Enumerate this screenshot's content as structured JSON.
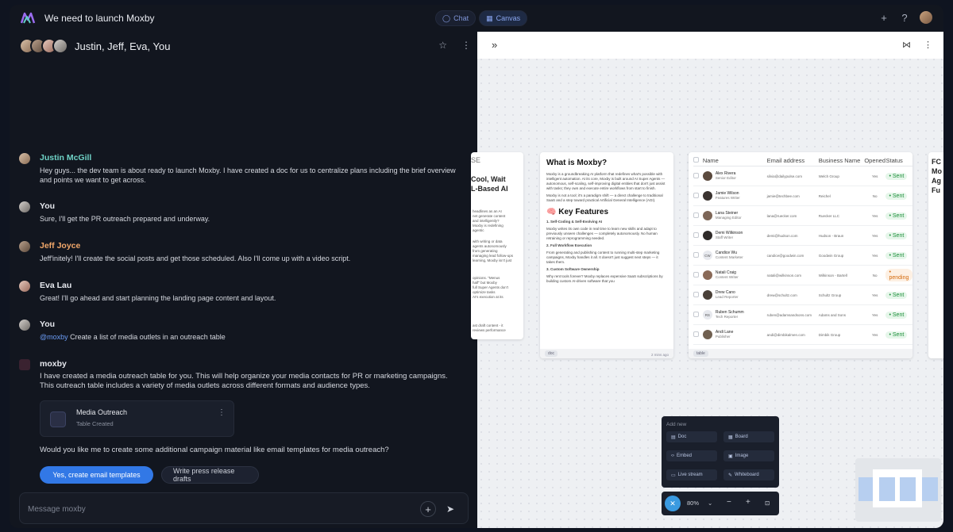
{
  "app": {
    "title": "We need to launch Moxby",
    "views": [
      "Chat",
      "Canvas"
    ],
    "active_view": "Canvas",
    "accent": "#3278e6"
  },
  "chat": {
    "header": "Justin, Jeff, Eva, You",
    "messages": [
      {
        "author": "Justin McGill",
        "color": "#6fd3c6",
        "text": "Hey guys... the dev team is about ready to launch Moxby. I have created a doc for us to centralize plans including the brief overview and points we want to get across."
      },
      {
        "author": "You",
        "color": "#e6e8ee",
        "text": "Sure, I'll get the PR outreach prepared and underway."
      },
      {
        "author": "Jeff Joyce",
        "color": "#f2a86a",
        "text": "Jeff'initely! I'll create the social posts and get those scheduled. Also I'll come up with a video script."
      },
      {
        "author": "Eva Lau",
        "color": "#e6e8ee",
        "text": "Great! I'll go ahead and start planning the landing page content and layout."
      },
      {
        "author": "You",
        "color": "#e6e8ee",
        "mention": "@moxby",
        "text": "Create a list of media outlets in an outreach table"
      },
      {
        "author": "moxby",
        "color": "#e6e8ee",
        "text": "I have created a media outreach table for you. This will help organize your media contacts for PR or marketing campaigns. This outreach table includes a variety of media outlets across different formats and audience types."
      }
    ],
    "attachment": {
      "name": "Media Outreach",
      "subtitle": "Table Created"
    },
    "question": "Would you like me to create some additional campaign material like email templates for media outreach?",
    "cta_primary": "Yes, create email templates",
    "cta_secondary": "Write press release drafts",
    "composer_placeholder": "Message moxby"
  },
  "canvas": {
    "card1": {
      "heading_alt": "SE",
      "heading": "Cool, Wait\nL-Based AI",
      "paragraphs": [
        "headlines as an AI\nnet generate content\nand intelligently?\nMoxby is redefining\nagentic",
        "with writing or data\nagents autonomously\nfrom generating\nmanaging lead follow-ups\nlearning, Moxby isn't just",
        "opinions. \"Menus\nhalf\" but Moxby\nfull Super Agents don't\noptimize tasks\nAI's execution at its",
        "ast draft content - it\nreviews performance"
      ]
    },
    "card2": {
      "title": "What is Moxby?",
      "p1": "Moxby is a groundbreaking AI platform that redefines what's possible with intelligent automation. At its core, Moxby is built around AI Super Agents — autonomous, self-scaling, self-improving digital entities that don't just assist with tasks; they own and execute entire workflows from start to finish.",
      "p2": "Moxby is not a tool; it's a paradigm shift — a direct challenge to traditional SaaS and a step toward practical Artificial General Intelligence (AGI).",
      "features_title": "🧠 Key Features",
      "f1_title": "1. Self-Coding & Self-Evolving AI",
      "f1": "Moxby writes its own code in real time to learn new skills and adapt to previously unseen challenges — completely autonomously. No human retraining or reprogramming needed.",
      "f2_title": "2. Full Workflow Execution",
      "f2": "From generating and publishing content to running multi-step marketing campaigns, Moxby handles it all. It doesn't just suggest next steps — it takes them.",
      "f3_title": "3. Custom Software Ownership",
      "f3": "Why rent tools forever? Moxby replaces expensive SaaS subscriptions by building custom AI-driven software that you",
      "tag": "doc",
      "timestamp": "2 mins ago"
    },
    "card3": {
      "headers": [
        "Name",
        "Email address",
        "Business Name",
        "Opened",
        "Status"
      ],
      "rows": [
        {
          "name": "Alex Rivera",
          "role": "Senior Editor",
          "email": "silvia@dailypulse.com",
          "biz": "Welch Group",
          "opened": "Yes",
          "status": "Sent",
          "initials": ""
        },
        {
          "name": "Jamie Wilson",
          "role": "Features Writer",
          "email": "jamie@techbee.com",
          "biz": "Reichel",
          "opened": "No",
          "status": "Sent",
          "initials": ""
        },
        {
          "name": "Lana Steiner",
          "role": "Managing Editor",
          "email": "lana@ruecker.com",
          "biz": "Ruecker LLC",
          "opened": "Yes",
          "status": "Sent",
          "initials": ""
        },
        {
          "name": "Demi Wilkinson",
          "role": "Staff Writer",
          "email": "demi@hudson.com",
          "biz": "Hudson - Braun",
          "opened": "Yes",
          "status": "Sent",
          "initials": ""
        },
        {
          "name": "Candice Wu",
          "role": "Content Marketer",
          "email": "candice@goodwin.com",
          "biz": "Goodwin Group",
          "opened": "Yes",
          "status": "Sent",
          "initials": "CW"
        },
        {
          "name": "Natali Craig",
          "role": "Content Writer",
          "email": "natali@wilkinson.com",
          "biz": "Wilkinson - Bartell",
          "opened": "No",
          "status": "pending",
          "initials": ""
        },
        {
          "name": "Drew Cano",
          "role": "Lead Reporter",
          "email": "drew@schultz.com",
          "biz": "Schultz Group",
          "opened": "Yes",
          "status": "Sent",
          "initials": ""
        },
        {
          "name": "Ruben Schumm",
          "role": "Tech Reporter",
          "email": "ruben@adamsandsons.com",
          "biz": "Adams and Sons",
          "opened": "Yes",
          "status": "Sent",
          "initials": "RS"
        },
        {
          "name": "Andi Lane",
          "role": "Publisher",
          "email": "andi@dimbikalmen.com",
          "biz": "Dimbik Group",
          "opened": "Yes",
          "status": "Sent",
          "initials": ""
        }
      ],
      "tag": "table"
    },
    "card4": {
      "heading": "FC\nMo\nAg\nFu"
    },
    "add_new": {
      "label": "Add new",
      "options": [
        "Doc",
        "Board",
        "Embed",
        "Image",
        "Live stream",
        "Whiteboard"
      ]
    },
    "zoom": "80%"
  }
}
